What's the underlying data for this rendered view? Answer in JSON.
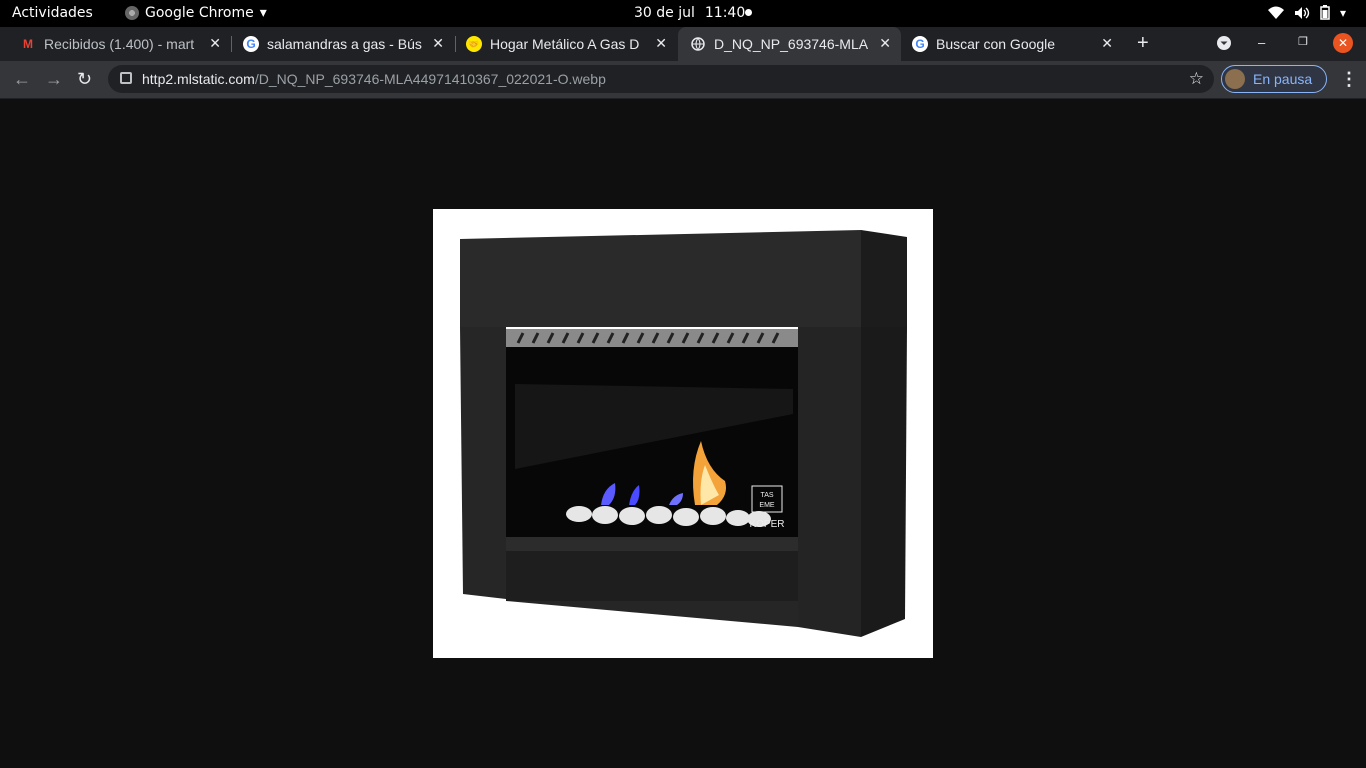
{
  "topbar": {
    "activities": "Actividades",
    "app_name": "Google Chrome",
    "date": "30 de jul",
    "time": "11:40"
  },
  "tabs": [
    {
      "title": "Recibidos (1.400) - mart",
      "favicon": "gmail-icon"
    },
    {
      "title": "salamandras a gas - Bús",
      "favicon": "google-icon"
    },
    {
      "title": "Hogar Metálico A Gas D",
      "favicon": "mercadolibre-icon"
    },
    {
      "title": "D_NQ_NP_693746-MLA",
      "favicon": "globe-icon",
      "active": true
    },
    {
      "title": "Buscar con Google",
      "favicon": "google-icon"
    }
  ],
  "toolbar": {
    "url_host": "http2.mlstatic.com",
    "url_path": "/D_NQ_NP_693746-MLA44971410367_022021-O.webp",
    "profile_label": "En pausa"
  },
  "image": {
    "brand_lines": [
      "TAS",
      "EME",
      "KOPER"
    ]
  },
  "colors": {
    "close_button": "#e95420",
    "profile_accent": "#8ab4f8"
  }
}
